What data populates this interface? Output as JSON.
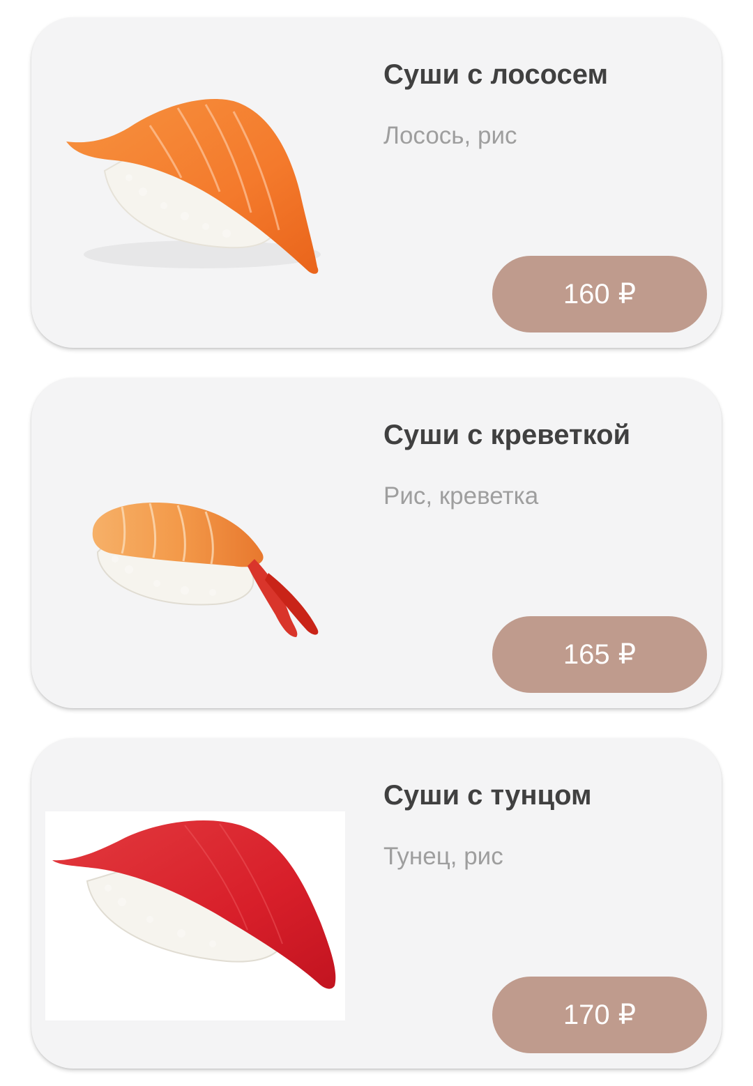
{
  "products": [
    {
      "title": "Суши с лососем",
      "ingredients": "Лосось, рис",
      "price": "160",
      "currency": "₽",
      "image_icon": "salmon-nigiri-image"
    },
    {
      "title": "Суши с креветкой",
      "ingredients": "Рис, креветка",
      "price": "165",
      "currency": "₽",
      "image_icon": "shrimp-nigiri-image"
    },
    {
      "title": "Суши с тунцом",
      "ingredients": "Тунец, рис",
      "price": "170",
      "currency": "₽",
      "image_icon": "tuna-nigiri-image"
    }
  ],
  "colors": {
    "card_background": "#f4f4f5",
    "price_button": "#bf9b8d",
    "title_text": "#404040",
    "subtitle_text": "#9e9e9e",
    "salmon": "#f47a2c",
    "shrimp": "#f39a4a",
    "tuna": "#d81f2a",
    "rice": "#f5f5f0"
  }
}
